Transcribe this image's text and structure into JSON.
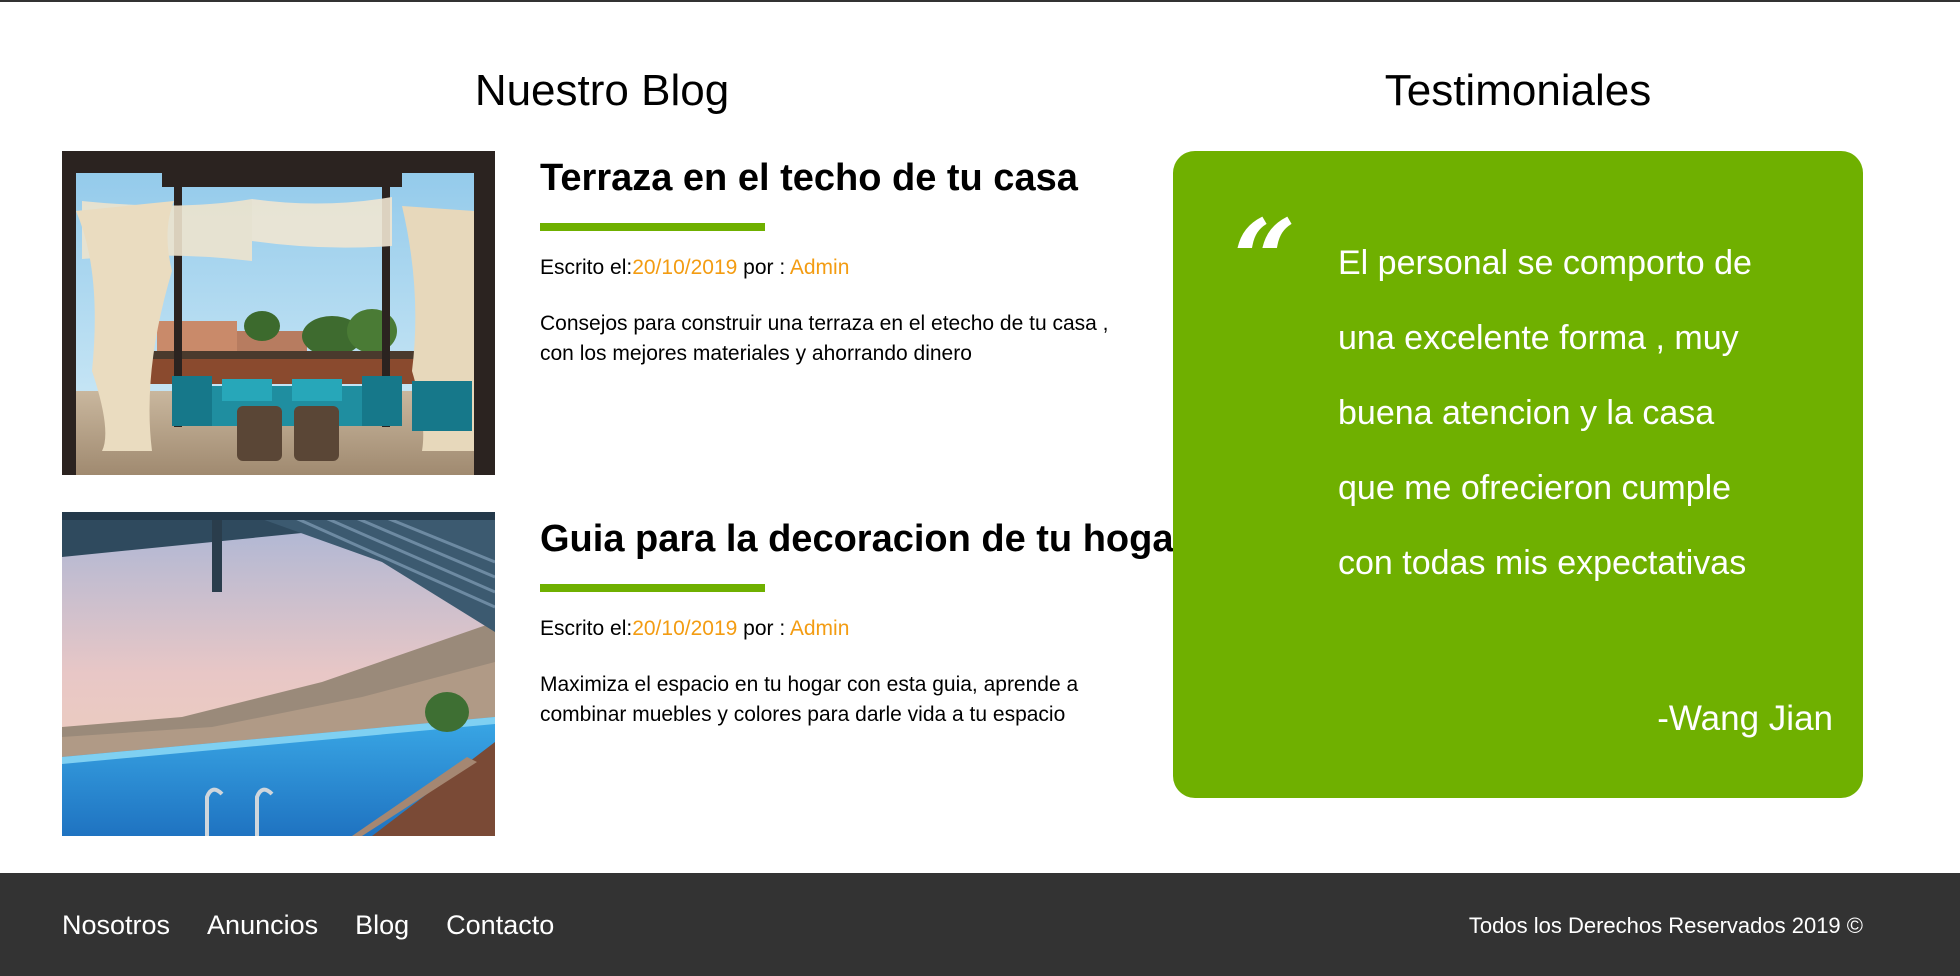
{
  "blog": {
    "heading": "Nuestro Blog",
    "entries": [
      {
        "title": "Terraza en el techo de tu casa",
        "meta_written": "Escrito el:",
        "date": "20/10/2019",
        "meta_by": " por : ",
        "author": "Admin",
        "excerpt": "Consejos para construir una terraza en el etecho de tu casa , con los mejores materiales y ahorrando dinero",
        "image": "rooftop-terrace-photo"
      },
      {
        "title": "Guia para la decoracion de tu hogar",
        "meta_written": "Escrito el:",
        "date": "20/10/2019",
        "meta_by": " por : ",
        "author": "Admin",
        "excerpt": "Maximiza el espacio en tu hogar con esta guia, aprende a combinar muebles y colores para darle vida a tu espacio",
        "image": "infinity-pool-photo"
      }
    ]
  },
  "testimonials": {
    "heading": "Testimoniales",
    "quote_icon": "quote-icon",
    "text": "El personal se comporto de una excelente forma , muy buena atencion y la casa que me ofrecieron cumple con todas mis expectativas",
    "author": "-Wang Jian"
  },
  "footer": {
    "nav": [
      {
        "label": "Nosotros"
      },
      {
        "label": "Anuncios"
      },
      {
        "label": "Blog"
      },
      {
        "label": "Contacto"
      }
    ],
    "copyright": "Todos los Derechos Reservados 2019 ©"
  },
  "colors": {
    "accent_green": "#6fb000",
    "accent_orange": "#f39c12",
    "footer_bg": "#333333",
    "text": "#000000"
  }
}
